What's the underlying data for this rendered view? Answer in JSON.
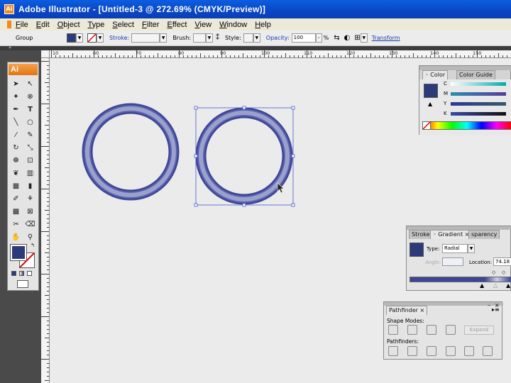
{
  "window": {
    "title": "Adobe Illustrator - [Untitled-3 @ 272.69% (CMYK/Preview)]",
    "app_icon_text": "Ai"
  },
  "menu": [
    "File",
    "Edit",
    "Object",
    "Type",
    "Select",
    "Filter",
    "Effect",
    "View",
    "Window",
    "Help"
  ],
  "control_bar": {
    "selection_label": "Group",
    "stroke_label": "Stroke:",
    "brush_label": "Brush:",
    "style_label": "Style:",
    "opacity_label": "Opacity:",
    "opacity_value": "100",
    "opacity_unit": "%",
    "transform_label": "Transform",
    "fill_color": "#2c3a7a"
  },
  "rulers": {
    "top": [
      "10",
      "60",
      "70",
      "80",
      "90",
      "100",
      "110",
      "120",
      "130",
      "140",
      "150"
    ]
  },
  "toolbox": {
    "logo": "Ai",
    "fill_color": "#2c3a7a"
  },
  "artwork": {
    "ring_color": "#3d4596",
    "highlight_color": "#c8cce4"
  },
  "color_panel": {
    "tabs": [
      "Color",
      "Color Guide"
    ],
    "channels": [
      "C",
      "M",
      "Y",
      "K"
    ],
    "swatch_color": "#2c3a7a"
  },
  "gradient_panel": {
    "tabs": [
      "Stroke",
      "Gradient",
      "sparency"
    ],
    "type_label": "Type:",
    "type_value": "Radial",
    "angle_label": "Angle:",
    "location_label": "Location:",
    "location_value": "74.18",
    "swatch_color": "#2c3a7a"
  },
  "pathfinder_panel": {
    "tab": "Pathfinder",
    "shape_modes_label": "Shape Modes:",
    "pathfinders_label": "Pathfinders:",
    "expand_label": "Expand"
  }
}
